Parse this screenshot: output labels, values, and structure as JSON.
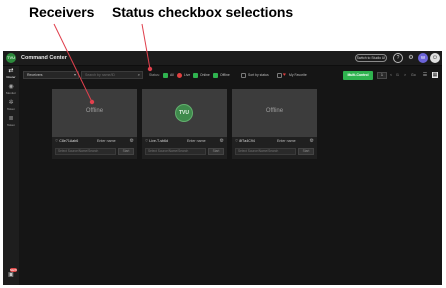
{
  "callouts": {
    "receivers": "Receivers",
    "status_selections": "Status checkbox selections"
  },
  "app": {
    "title": "Command Center",
    "logo_text": "TVU",
    "switch_button": "Switch to Studio UI",
    "topbar_icons": [
      "help-icon",
      "gear-icon",
      "user-avatar",
      "power-icon"
    ],
    "user_initial": "W"
  },
  "sidenav": {
    "items": [
      {
        "label": "Router",
        "icon": "tv-icon"
      },
      {
        "label": "Monitor",
        "icon": "eye-icon"
      },
      {
        "label": "Token",
        "icon": "share-icon"
      },
      {
        "label": "Token",
        "icon": "list-icon"
      }
    ],
    "badge": "NEW"
  },
  "filters": {
    "type_select": "Receivers",
    "search_placeholder": "Search by name/ID",
    "status_label": "Status:",
    "statuses": [
      {
        "label": "All",
        "checked": true
      },
      {
        "label": "Live",
        "checked": false
      },
      {
        "label": "Online",
        "checked": true
      },
      {
        "label": "Offline",
        "checked": true
      },
      {
        "label": "Sort by status",
        "checked": false
      },
      {
        "label": "My Favorite",
        "checked": false
      }
    ],
    "multi_control": "Multi-Control",
    "page_number": "1",
    "pager_total": "/1",
    "pager_controls": [
      "<",
      ">",
      "Go"
    ]
  },
  "receivers": [
    {
      "state": "Offline",
      "id": "C8e71Aab6",
      "name_placeholder": "Enter name",
      "source_placeholder": "Select Source/Name/Search",
      "start_label": "Start"
    },
    {
      "state": "Online",
      "preview_logo": "TVU",
      "id": "Live-T-sb6d",
      "name_placeholder": "Enter name",
      "source_placeholder": "Select Source/Name/Search",
      "start_label": "Start"
    },
    {
      "state": "Offline",
      "id": "8f7a4C94",
      "name_placeholder": "Enter name",
      "source_placeholder": "Select Source/Name/Search",
      "start_label": "Start"
    }
  ],
  "colors": {
    "accent_green": "#2fb34f",
    "background": "#151515",
    "card_preview": "#3c3c3c",
    "callout_leader": "#e0404d"
  }
}
